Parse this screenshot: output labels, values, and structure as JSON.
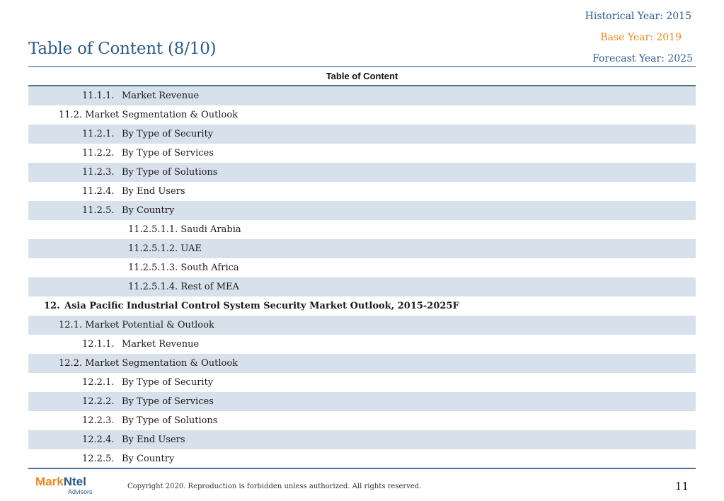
{
  "header": {
    "historical": "Historical Year: 2015",
    "base": "Base Year: 2019",
    "forecast": "Forecast Year: 2025",
    "title": "Table of Content (8/10)"
  },
  "table": {
    "heading": "Table of Content",
    "rows": [
      {
        "level": 2,
        "num": "11.1.1.",
        "text": "Market Revenue"
      },
      {
        "level": 1,
        "num": "",
        "text": "11.2. Market Segmentation & Outlook"
      },
      {
        "level": 2,
        "num": "11.2.1.",
        "text": "By Type of Security"
      },
      {
        "level": 2,
        "num": "11.2.2.",
        "text": "By Type of Services"
      },
      {
        "level": 2,
        "num": "11.2.3.",
        "text": "By Type of Solutions"
      },
      {
        "level": 2,
        "num": "11.2.4.",
        "text": "By End Users"
      },
      {
        "level": 2,
        "num": "11.2.5.",
        "text": "By Country"
      },
      {
        "level": 3,
        "num": "",
        "text": "11.2.5.1.1. Saudi Arabia"
      },
      {
        "level": 3,
        "num": "",
        "text": "11.2.5.1.2. UAE"
      },
      {
        "level": 3,
        "num": "",
        "text": "11.2.5.1.3. South Africa"
      },
      {
        "level": 3,
        "num": "",
        "text": "11.2.5.1.4. Rest of MEA"
      },
      {
        "level": 0,
        "num": "12.",
        "text": "Asia Pacific Industrial Control System Security Market Outlook, 2015-2025F"
      },
      {
        "level": 1,
        "num": "",
        "text": "12.1. Market Potential & Outlook"
      },
      {
        "level": 2,
        "num": "12.1.1.",
        "text": "Market Revenue"
      },
      {
        "level": 1,
        "num": "",
        "text": "12.2. Market Segmentation & Outlook"
      },
      {
        "level": 2,
        "num": "12.2.1.",
        "text": "By Type of Security"
      },
      {
        "level": 2,
        "num": "12.2.2.",
        "text": "By Type of Services"
      },
      {
        "level": 2,
        "num": "12.2.3.",
        "text": "By Type of Solutions"
      },
      {
        "level": 2,
        "num": "12.2.4.",
        "text": "By End Users"
      },
      {
        "level": 2,
        "num": "12.2.5.",
        "text": "By Country"
      }
    ]
  },
  "footer": {
    "logo_part1": "Mark",
    "logo_part2": "Ntel",
    "logo_sub": "Advisors",
    "copyright": "Copyright 2020. Reproduction is forbidden unless authorized. All rights reserved.",
    "page_number": "11"
  },
  "colors": {
    "accent_blue": "#2a5a8a",
    "accent_orange": "#e8891e",
    "row_shade": "#d7e1eb"
  }
}
